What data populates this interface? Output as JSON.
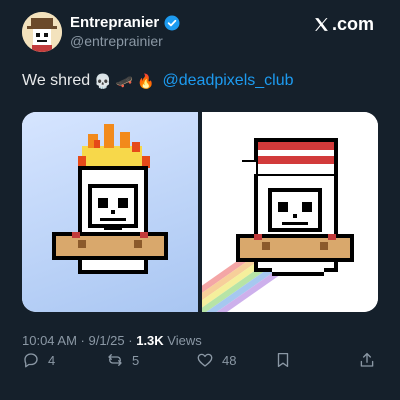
{
  "author": {
    "display_name": "Entrepranier",
    "handle": "@entreprainier"
  },
  "platform": {
    "logo_text": ".com"
  },
  "tweet": {
    "text": "We shred",
    "emojis": [
      "💀",
      "🛹",
      "🔥"
    ],
    "mention": "@deadpixels_club"
  },
  "meta": {
    "time": "10:04 AM",
    "sep1": " · ",
    "date": "9/1/25",
    "sep2": " · ",
    "views_count": "1.3K",
    "views_label": " Views"
  },
  "actions": {
    "replies": "4",
    "reposts": "5",
    "likes": "48"
  },
  "colors": {
    "background": "#15202b",
    "accent": "#1d9bf0",
    "muted": "#8b98a5"
  },
  "icons": [
    "verified-badge-icon",
    "x-logo-icon",
    "reply-icon",
    "repost-icon",
    "like-icon",
    "bookmark-icon",
    "share-icon"
  ]
}
